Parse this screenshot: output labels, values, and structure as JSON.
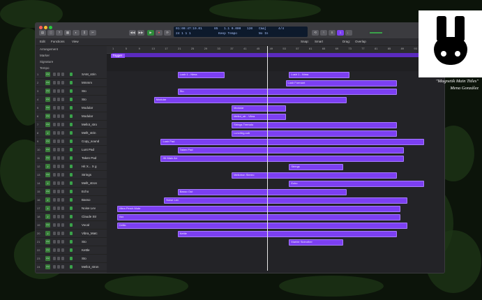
{
  "window": {
    "title": ""
  },
  "transport": {
    "lcd_position": "01:00:47:19.01",
    "lcd_bar": "85",
    "lcd_beat": "1.1 0.000",
    "lcd_tempo": "120",
    "lcd_key": "Cmaj",
    "lcd_sig": "4/4",
    "lcd_line2": "24   1   1   1",
    "lcd_line2b": "Keep Tempo",
    "lcd_line2c": "No In"
  },
  "toolbar": {
    "edit": "Edit",
    "functions": "Functions",
    "view": "View",
    "snap": "Snap:",
    "smart": "Smart",
    "drag": "Drag:",
    "overlap": "Overlap"
  },
  "global_tracks": [
    "Arrangement",
    "Marker",
    "Signature",
    "Tempo"
  ],
  "ruler_ticks": [
    "1",
    "5",
    "9",
    "13",
    "17",
    "21",
    "25",
    "29",
    "33",
    "37",
    "41",
    "45",
    "49",
    "53",
    "57",
    "61",
    "65",
    "69",
    "73",
    "77",
    "81",
    "85",
    "89",
    "93",
    "97",
    "101"
  ],
  "marker_label": "Trigger",
  "tracks": [
    {
      "num": "1",
      "name": "SAM_strin",
      "inst": false
    },
    {
      "num": "2",
      "name": "Mmmm",
      "inst": false
    },
    {
      "num": "3",
      "name": "Sto",
      "inst": false
    },
    {
      "num": "4",
      "name": "Sto",
      "inst": false
    },
    {
      "num": "5",
      "name": "Modular",
      "inst": false
    },
    {
      "num": "6",
      "name": "Modular",
      "inst": false
    },
    {
      "num": "7",
      "name": "Mellot_stro",
      "inst": false
    },
    {
      "num": "8",
      "name": "Mellt_strin",
      "inst": true
    },
    {
      "num": "9",
      "name": "Copy_sound",
      "inst": false
    },
    {
      "num": "10",
      "name": "Lunt Pad",
      "inst": false
    },
    {
      "num": "11",
      "name": "Taken Pad",
      "inst": false
    },
    {
      "num": "12",
      "name": "Hit X... X g",
      "inst": true
    },
    {
      "num": "13",
      "name": "Strings",
      "inst": false
    },
    {
      "num": "14",
      "name": "Mellt_stron",
      "inst": true
    },
    {
      "num": "15",
      "name": "Echo",
      "inst": false
    },
    {
      "num": "16",
      "name": "Basso",
      "inst": true
    },
    {
      "num": "17",
      "name": "Noise Lev",
      "inst": true
    },
    {
      "num": "18",
      "name": "Claude Str",
      "inst": true
    },
    {
      "num": "19",
      "name": "Vocal",
      "inst": false
    },
    {
      "num": "20",
      "name": "Vibra_Matc",
      "inst": true
    },
    {
      "num": "21",
      "name": "Sto",
      "inst": false
    },
    {
      "num": "22",
      "name": "Kettle",
      "inst": false
    },
    {
      "num": "23",
      "name": "Sto",
      "inst": false
    },
    {
      "num": "24",
      "name": "Mellot_stron",
      "inst": false
    }
  ],
  "regions": [
    {
      "track": 1,
      "start": 0.21,
      "end": 0.35,
      "label": "Lush 1 - Nima"
    },
    {
      "track": 1,
      "start": 0.54,
      "end": 0.72,
      "label": "Lush 1 - Nima"
    },
    {
      "track": 2,
      "start": 0.53,
      "end": 0.86,
      "label": "Lush Formant"
    },
    {
      "track": 3,
      "start": 0.21,
      "end": 0.86,
      "label": "Sto"
    },
    {
      "track": 4,
      "start": 0.14,
      "end": 0.71,
      "label": "Modular"
    },
    {
      "track": 5,
      "start": 0.37,
      "end": 0.53,
      "label": "Modular"
    },
    {
      "track": 6,
      "start": 0.37,
      "end": 0.53,
      "label": "Mellot_str - Vibra"
    },
    {
      "track": 7,
      "start": 0.37,
      "end": 0.86,
      "label": "Strings Tremolo"
    },
    {
      "track": 8,
      "start": 0.37,
      "end": 0.86,
      "label": "Lunchbg-sub"
    },
    {
      "track": 9,
      "start": 0.16,
      "end": 0.94,
      "label": "Lush Pad"
    },
    {
      "track": 10,
      "start": 0.21,
      "end": 0.88,
      "label": "Taken Pad"
    },
    {
      "track": 11,
      "start": 0.16,
      "end": 0.88,
      "label": "Hit Main Arr"
    },
    {
      "track": 12,
      "start": 0.54,
      "end": 0.7,
      "label": "Strings"
    },
    {
      "track": 13,
      "start": 0.37,
      "end": 0.86,
      "label": "Mellotron Stereo"
    },
    {
      "track": 14,
      "start": 0.54,
      "end": 0.94,
      "label": "Echo"
    },
    {
      "track": 15,
      "start": 0.21,
      "end": 0.71,
      "label": "Basso Out"
    },
    {
      "track": 16,
      "start": 0.17,
      "end": 0.89,
      "label": "Noise Lev"
    },
    {
      "track": 17,
      "start": 0.03,
      "end": 0.87,
      "label": "Vibra Perch Mute"
    },
    {
      "track": 18,
      "start": 0.03,
      "end": 0.87,
      "label": "Vox"
    },
    {
      "track": 19,
      "start": 0.03,
      "end": 0.89,
      "label": "Celtic"
    },
    {
      "track": 20,
      "start": 0.21,
      "end": 0.86,
      "label": "Kettle"
    },
    {
      "track": 21,
      "start": 0.54,
      "end": 0.7,
      "label": "Marble Sideother"
    }
  ],
  "overlay": {
    "caption_title": "\"Magnetik Main Titles\"",
    "caption_author": "Mena González"
  },
  "colors": {
    "region": "#7c3ff2",
    "region_border": "#a77bff",
    "cycle": "#5b2bbf"
  }
}
